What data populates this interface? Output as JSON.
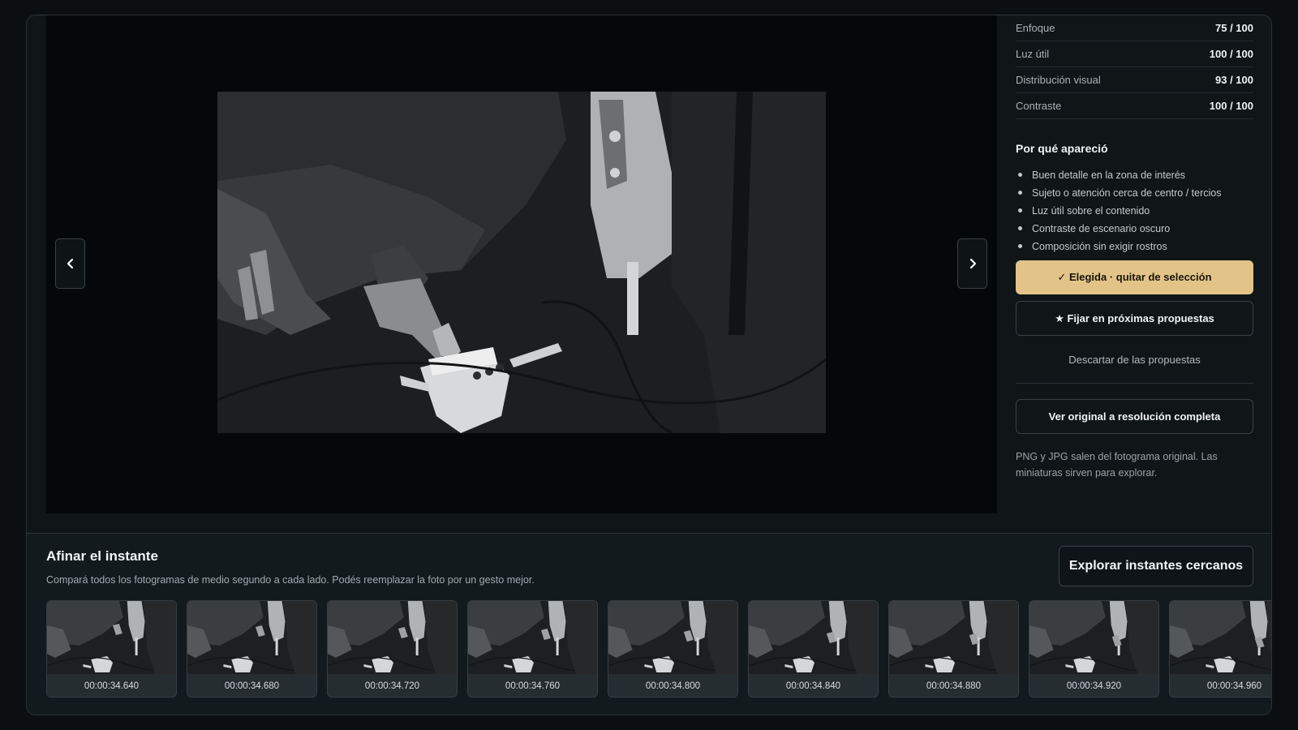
{
  "viewer": {
    "prev_icon": "chevron-left-icon",
    "next_icon": "chevron-right-icon"
  },
  "panel": {
    "metrics": [
      {
        "label": "Enfoque",
        "value": "75 / 100"
      },
      {
        "label": "Luz útil",
        "value": "100 / 100"
      },
      {
        "label": "Distribución visual",
        "value": "93 / 100"
      },
      {
        "label": "Contraste",
        "value": "100 / 100"
      }
    ],
    "why_title": "Por qué apareció",
    "reasons": [
      "Buen detalle en la zona de interés",
      "Sujeto o atención cerca de centro / tercios",
      "Luz útil sobre el contenido",
      "Contraste de escenario oscuro",
      "Composición sin exigir rostros"
    ],
    "selected_label": "✓ Elegida · quitar de selección",
    "pin_label": "★ Fijar en próximas propuestas",
    "discard_label": "Descartar de las propuestas",
    "original_label": "Ver original a resolución completa",
    "note": "PNG y JPG salen del fotograma original. Las miniaturas sirven para explorar.",
    "accent_color": "#e2c489"
  },
  "refine": {
    "title": "Afinar el instante",
    "description": "Compará todos los fotogramas de medio segundo a cada lado. Podés reemplazar la foto por un gesto mejor.",
    "explore_label": "Explorar instantes cercanos",
    "frames": [
      "00:00:34.640",
      "00:00:34.680",
      "00:00:34.720",
      "00:00:34.760",
      "00:00:34.800",
      "00:00:34.840",
      "00:00:34.880",
      "00:00:34.920",
      "00:00:34.960"
    ]
  }
}
